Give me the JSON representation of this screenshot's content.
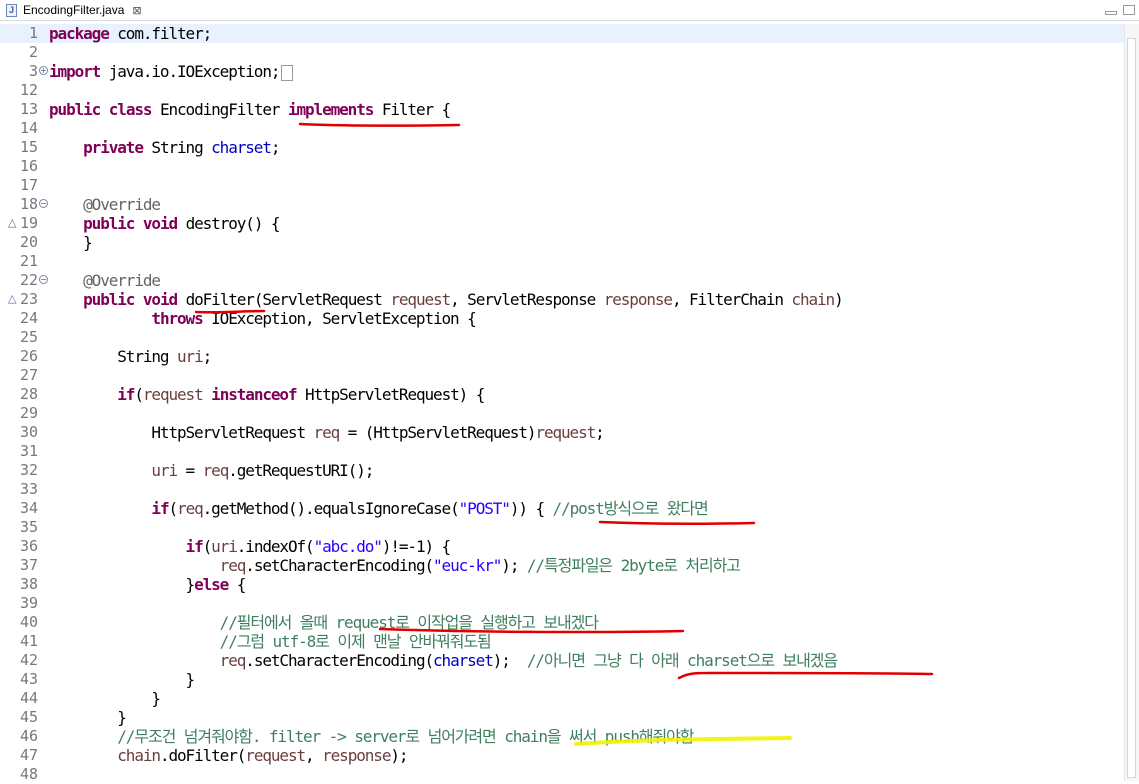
{
  "tab": {
    "filename": "EncodingFilter.java",
    "icon_letter": "J",
    "close_glyph": "⊠"
  },
  "lines": [
    {
      "n": "1",
      "current": true,
      "tokens": [
        {
          "t": "package",
          "c": "kw"
        },
        {
          "t": " com.filter;"
        }
      ]
    },
    {
      "n": "2",
      "tokens": []
    },
    {
      "n": "3",
      "fold": "+",
      "tokens": [
        {
          "t": "import",
          "c": "kw"
        },
        {
          "t": " java.io.IOException;"
        }
      ],
      "collapsed": true
    },
    {
      "n": "12",
      "tokens": []
    },
    {
      "n": "13",
      "tokens": [
        {
          "t": "public",
          "c": "kw"
        },
        {
          "t": " "
        },
        {
          "t": "class",
          "c": "kw"
        },
        {
          "t": " EncodingFilter "
        },
        {
          "t": "implements",
          "c": "kw"
        },
        {
          "t": " Filter {"
        }
      ]
    },
    {
      "n": "14",
      "tokens": []
    },
    {
      "n": "15",
      "tokens": [
        {
          "t": "    "
        },
        {
          "t": "private",
          "c": "kw"
        },
        {
          "t": " String "
        },
        {
          "t": "charset",
          "c": "fld"
        },
        {
          "t": ";"
        }
      ]
    },
    {
      "n": "16",
      "tokens": []
    },
    {
      "n": "17",
      "tokens": []
    },
    {
      "n": "18",
      "fold": "−",
      "tokens": [
        {
          "t": "    "
        },
        {
          "t": "@Override",
          "c": "ann"
        }
      ]
    },
    {
      "n": "19",
      "override": true,
      "tokens": [
        {
          "t": "    "
        },
        {
          "t": "public",
          "c": "kw"
        },
        {
          "t": " "
        },
        {
          "t": "void",
          "c": "kw"
        },
        {
          "t": " destroy() {"
        }
      ]
    },
    {
      "n": "20",
      "tokens": [
        {
          "t": "    }"
        }
      ]
    },
    {
      "n": "21",
      "tokens": []
    },
    {
      "n": "22",
      "fold": "−",
      "tokens": [
        {
          "t": "    "
        },
        {
          "t": "@Override",
          "c": "ann"
        }
      ]
    },
    {
      "n": "23",
      "override": true,
      "tokens": [
        {
          "t": "    "
        },
        {
          "t": "public",
          "c": "kw"
        },
        {
          "t": " "
        },
        {
          "t": "void",
          "c": "kw"
        },
        {
          "t": " doFilter(ServletRequest "
        },
        {
          "t": "request",
          "c": "prm"
        },
        {
          "t": ", ServletResponse "
        },
        {
          "t": "response",
          "c": "prm"
        },
        {
          "t": ", FilterChain "
        },
        {
          "t": "chain",
          "c": "prm"
        },
        {
          "t": ")"
        }
      ]
    },
    {
      "n": "24",
      "tokens": [
        {
          "t": "            "
        },
        {
          "t": "throws",
          "c": "kw"
        },
        {
          "t": " IOException, ServletException {"
        }
      ]
    },
    {
      "n": "25",
      "tokens": []
    },
    {
      "n": "26",
      "tokens": [
        {
          "t": "        String "
        },
        {
          "t": "uri",
          "c": "prm"
        },
        {
          "t": ";"
        }
      ]
    },
    {
      "n": "27",
      "tokens": []
    },
    {
      "n": "28",
      "tokens": [
        {
          "t": "        "
        },
        {
          "t": "if",
          "c": "kw"
        },
        {
          "t": "("
        },
        {
          "t": "request",
          "c": "prm"
        },
        {
          "t": " "
        },
        {
          "t": "instanceof",
          "c": "kw"
        },
        {
          "t": " HttpServletRequest) {"
        }
      ]
    },
    {
      "n": "29",
      "tokens": []
    },
    {
      "n": "30",
      "tokens": [
        {
          "t": "            HttpServletRequest "
        },
        {
          "t": "req",
          "c": "prm"
        },
        {
          "t": " = (HttpServletRequest)"
        },
        {
          "t": "request",
          "c": "prm"
        },
        {
          "t": ";"
        }
      ]
    },
    {
      "n": "31",
      "tokens": []
    },
    {
      "n": "32",
      "tokens": [
        {
          "t": "            "
        },
        {
          "t": "uri",
          "c": "prm"
        },
        {
          "t": " = "
        },
        {
          "t": "req",
          "c": "prm"
        },
        {
          "t": ".getRequestURI();"
        }
      ]
    },
    {
      "n": "33",
      "tokens": []
    },
    {
      "n": "34",
      "tokens": [
        {
          "t": "            "
        },
        {
          "t": "if",
          "c": "kw"
        },
        {
          "t": "("
        },
        {
          "t": "req",
          "c": "prm"
        },
        {
          "t": ".getMethod().equalsIgnoreCase("
        },
        {
          "t": "\"POST\"",
          "c": "str"
        },
        {
          "t": ")) { "
        },
        {
          "t": "//post방식으로 왔다면",
          "c": "cmt"
        }
      ]
    },
    {
      "n": "35",
      "tokens": []
    },
    {
      "n": "36",
      "tokens": [
        {
          "t": "                "
        },
        {
          "t": "if",
          "c": "kw"
        },
        {
          "t": "("
        },
        {
          "t": "uri",
          "c": "prm"
        },
        {
          "t": ".indexOf("
        },
        {
          "t": "\"abc.do\"",
          "c": "str"
        },
        {
          "t": ")!=-1) {"
        }
      ]
    },
    {
      "n": "37",
      "tokens": [
        {
          "t": "                    "
        },
        {
          "t": "req",
          "c": "prm"
        },
        {
          "t": ".setCharacterEncoding("
        },
        {
          "t": "\"euc-kr\"",
          "c": "str"
        },
        {
          "t": "); "
        },
        {
          "t": "//특정파일은 2byte로 처리하고",
          "c": "cmt"
        }
      ]
    },
    {
      "n": "38",
      "tokens": [
        {
          "t": "                }"
        },
        {
          "t": "else",
          "c": "kw"
        },
        {
          "t": " {"
        }
      ]
    },
    {
      "n": "39",
      "tokens": []
    },
    {
      "n": "40",
      "tokens": [
        {
          "t": "                    "
        },
        {
          "t": "//필터에서 올때 request로 이작업을 실행하고 보내겠다",
          "c": "cmt"
        }
      ]
    },
    {
      "n": "41",
      "tokens": [
        {
          "t": "                    "
        },
        {
          "t": "//그럼 utf-8로 이제 맨날 안바꿔줘도됨",
          "c": "cmt"
        }
      ]
    },
    {
      "n": "42",
      "tokens": [
        {
          "t": "                    "
        },
        {
          "t": "req",
          "c": "prm"
        },
        {
          "t": ".setCharacterEncoding("
        },
        {
          "t": "charset",
          "c": "fld"
        },
        {
          "t": ");  "
        },
        {
          "t": "//아니면 그냥 다 아래 charset으로 보내겠음",
          "c": "cmt"
        }
      ]
    },
    {
      "n": "43",
      "tokens": [
        {
          "t": "                }"
        }
      ]
    },
    {
      "n": "44",
      "tokens": [
        {
          "t": "            }"
        }
      ]
    },
    {
      "n": "45",
      "tokens": [
        {
          "t": "        }"
        }
      ]
    },
    {
      "n": "46",
      "tokens": [
        {
          "t": "        "
        },
        {
          "t": "//무조건 넘겨줘야함. filter -> server로 넘어가려면 chain을 써서 push해줘야함",
          "c": "cmt"
        }
      ]
    },
    {
      "n": "47",
      "tokens": [
        {
          "t": "        "
        },
        {
          "t": "chain",
          "c": "prm"
        },
        {
          "t": ".doFilter("
        },
        {
          "t": "request",
          "c": "prm"
        },
        {
          "t": ", "
        },
        {
          "t": "response",
          "c": "prm"
        },
        {
          "t": ");"
        }
      ]
    },
    {
      "n": "48",
      "tokens": []
    }
  ],
  "colors": {
    "keyword": "#7f0055",
    "field": "#0000c0",
    "param": "#6a3e3e",
    "string": "#2a00ff",
    "comment": "#3f7f5f",
    "annotation": "#646464",
    "markup_red": "#e00000",
    "markup_yellow": "#f2f200"
  }
}
